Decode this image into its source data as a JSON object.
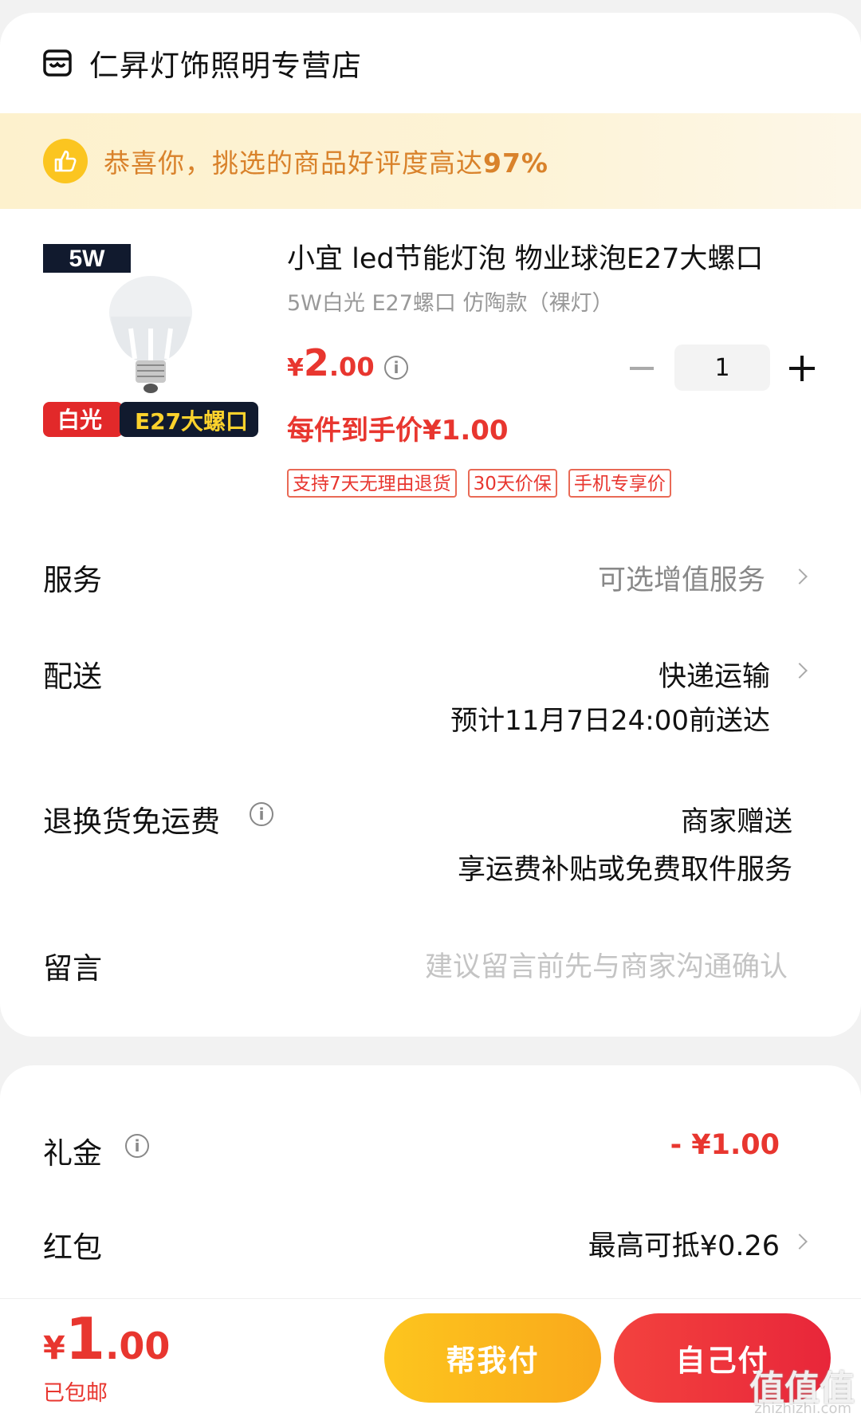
{
  "shop": {
    "name": "仁昇灯饰照明专营店",
    "icon": "store-icon"
  },
  "praise": {
    "prefix": "恭喜你，挑选的商品好评度高达",
    "value": "97%",
    "icon": "thumbs-up-icon"
  },
  "product": {
    "image_badges": {
      "power": "5W",
      "light": "白光",
      "socket": "E27大螺口"
    },
    "title": "小宜 led节能灯泡 物业球泡E27大螺口",
    "spec": "5W白光 E27螺口 仿陶款（裸灯）",
    "price": {
      "currency": "¥",
      "integer": "2",
      "decimal": ".00"
    },
    "quantity": "1",
    "unit_price": "每件到手价¥1.00",
    "tags": [
      "支持7天无理由退货",
      "30天价保",
      "手机专享价"
    ]
  },
  "rows": {
    "service": {
      "label": "服务",
      "value": "可选增值服务"
    },
    "delivery": {
      "label": "配送",
      "value": "快递运输",
      "eta": "预计11月7日24:00前送达"
    },
    "return_fee": {
      "label": "退换货免运费",
      "value": "商家赠送",
      "detail": "享运费补贴或免费取件服务"
    },
    "message": {
      "label": "留言",
      "placeholder": "建议留言前先与商家沟通确认"
    }
  },
  "discounts": {
    "gift": {
      "label": "礼金",
      "value": "- ¥1.00"
    },
    "red_packet": {
      "label": "红包",
      "value": "最高可抵¥0.26"
    }
  },
  "footer": {
    "total": {
      "currency": "¥",
      "integer": "1",
      "decimal": ".00"
    },
    "shipping_note": "已包邮",
    "help_pay": "帮我付",
    "self_pay": "自己付",
    "watermark": "值值值",
    "watermark_url": "zhizhizhi.com"
  },
  "colors": {
    "accent": "#e8362f",
    "gold": "#fbc520",
    "praise_text": "#d9822b"
  }
}
